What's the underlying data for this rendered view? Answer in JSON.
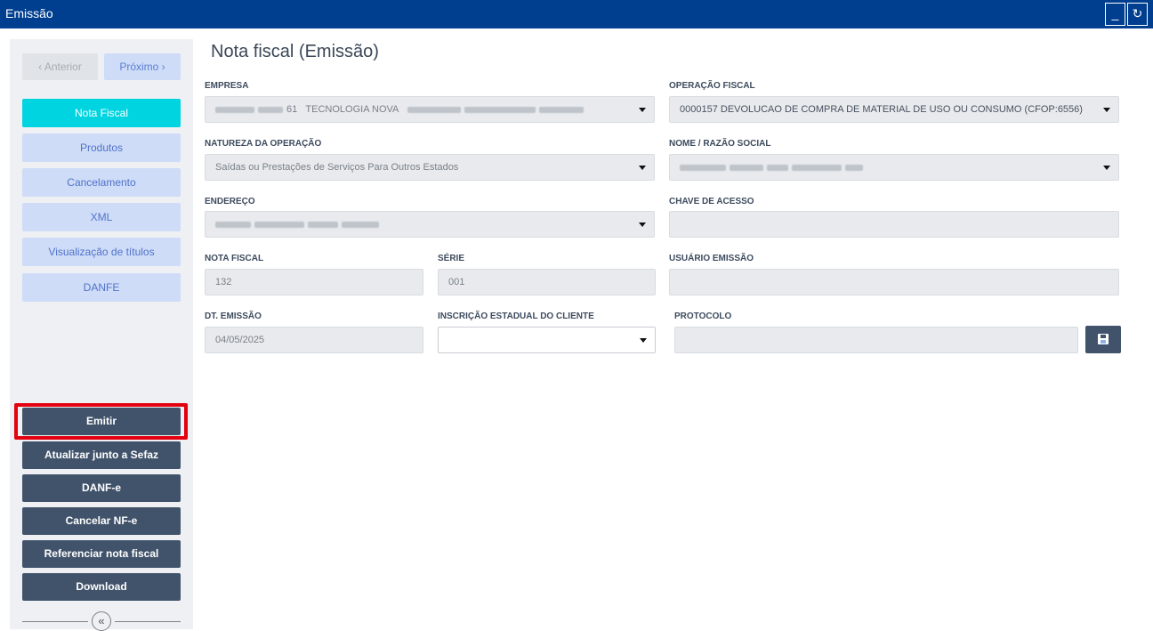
{
  "window": {
    "title": "Emissão",
    "minimize": "_",
    "refresh": "↻"
  },
  "nav": {
    "prev": "‹  Anterior",
    "next": "Próximo  ›"
  },
  "sidebar": {
    "items": [
      "Nota Fiscal",
      "Produtos",
      "Cancelamento",
      "XML",
      "Visualização de títulos",
      "DANFE"
    ],
    "active": "Nota Fiscal",
    "actions": [
      "Emitir",
      "Atualizar junto a Sefaz",
      "DANF-e",
      "Cancelar NF-e",
      "Referenciar nota fiscal",
      "Download"
    ],
    "collapse": "«"
  },
  "page": {
    "title": "Nota fiscal (Emissão)"
  },
  "form": {
    "empresa": {
      "label": "EMPRESA",
      "value": "TECNOLOGIA NOVA",
      "prefix": "61"
    },
    "operacao": {
      "label": "OPERAÇÃO FISCAL",
      "value": "0000157   DEVOLUCAO DE COMPRA DE MATERIAL DE USO OU CONSUMO (CFOP:6556)"
    },
    "natureza": {
      "label": "NATUREZA DA OPERAÇÃO",
      "value": "Saídas ou Prestações de Serviços Para Outros Estados"
    },
    "nome": {
      "label": "NOME / RAZÃO SOCIAL",
      "value": ""
    },
    "endereco": {
      "label": "ENDEREÇO",
      "value": ""
    },
    "chave": {
      "label": "CHAVE DE ACESSO",
      "value": ""
    },
    "nota": {
      "label": "NOTA FISCAL",
      "value": "132"
    },
    "serie": {
      "label": "SÉRIE",
      "value": "001"
    },
    "usuario": {
      "label": "USUÁRIO EMISSÃO",
      "value": ""
    },
    "emissao": {
      "label": "DT. EMISSÃO",
      "value": "04/05/2025"
    },
    "inscricao": {
      "label": "INSCRIÇÃO ESTADUAL DO CLIENTE",
      "value": ""
    },
    "protocolo": {
      "label": "PROTOCOLO",
      "value": ""
    }
  },
  "colors": {
    "header": "#003f8f",
    "accent": "#00d4e0",
    "action": "#41536b",
    "highlight": "#e3000f"
  }
}
